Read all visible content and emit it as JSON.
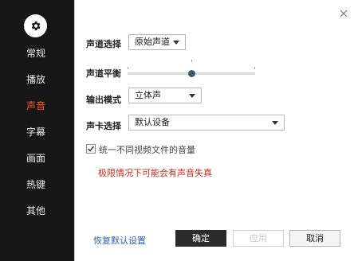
{
  "sidebar": {
    "items": [
      {
        "label": "常规",
        "active": false
      },
      {
        "label": "播放",
        "active": false
      },
      {
        "label": "声音",
        "active": true
      },
      {
        "label": "字幕",
        "active": false
      },
      {
        "label": "画面",
        "active": false
      },
      {
        "label": "热键",
        "active": false
      },
      {
        "label": "其他",
        "active": false
      }
    ],
    "active_color": "#ff5a1f"
  },
  "audio": {
    "channel_label": "声道选择",
    "channel_value": "原始声道",
    "balance_label": "声道平衡",
    "balance_level": 0.5,
    "output_label": "输出模式",
    "output_value": "立体声",
    "device_label": "声卡选择",
    "device_value": "默认设备",
    "unify_label": "统一不同视频文件的音量",
    "unify_checked": true,
    "warning": "极限情况下可能会有声音失真",
    "warning_color": "#d02a1a"
  },
  "footer": {
    "restore_label": "恢复默认设置",
    "ok_label": "确定",
    "apply_label": "应用",
    "cancel_label": "取消"
  }
}
